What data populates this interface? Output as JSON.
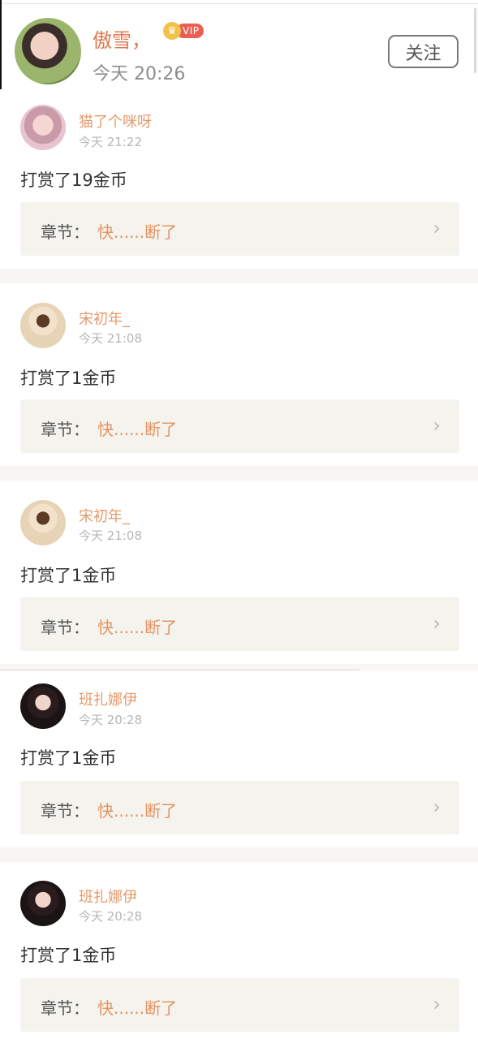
{
  "author": {
    "name": "傲雪，",
    "vip_label": "VIP",
    "time": "今天 20:26",
    "follow_label": "关注"
  },
  "chapter_prefix": "章节：",
  "chapter_icon": "chevron-right-icon",
  "entries": [
    {
      "user": "猫了个咪呀",
      "time": "今天 21:22",
      "reward": "打赏了19金币",
      "chapter": "快......断了"
    },
    {
      "user": "宋初年_",
      "time": "今天 21:08",
      "reward": "打赏了1金币",
      "chapter": "快......断了"
    },
    {
      "user": "宋初年_",
      "time": "今天 21:08",
      "reward": "打赏了1金币",
      "chapter": "快......断了"
    },
    {
      "user": "班扎娜伊",
      "time": "今天 20:28",
      "reward": "打赏了1金币",
      "chapter": "快......断了"
    },
    {
      "user": "班扎娜伊",
      "time": "今天 20:28",
      "reward": "打赏了1金币",
      "chapter": "快......断了"
    }
  ]
}
